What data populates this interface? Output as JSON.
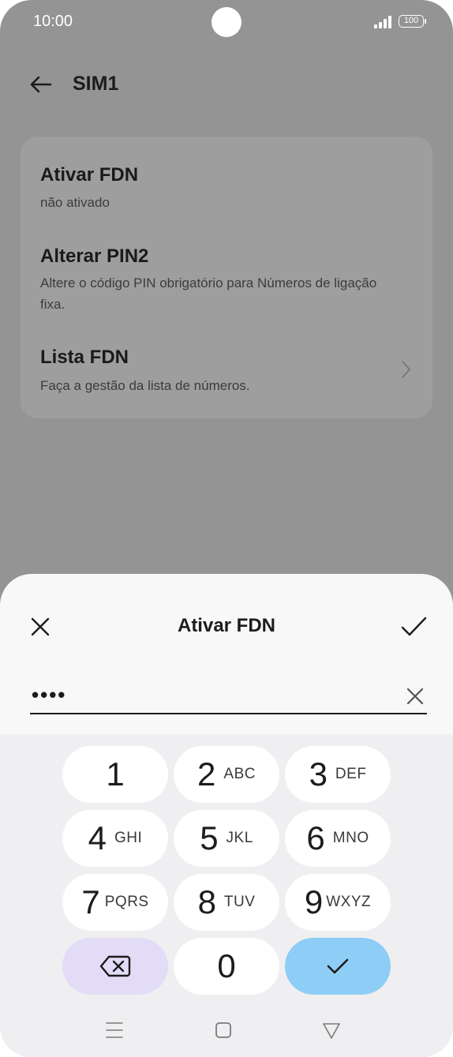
{
  "status_bar": {
    "time": "10:00",
    "battery": "100"
  },
  "header": {
    "title": "SIM1"
  },
  "settings": [
    {
      "title": "Ativar FDN",
      "subtitle": "não ativado"
    },
    {
      "title": "Alterar PIN2",
      "subtitle": "Altere o código PIN obrigatório para Números de ligação fixa."
    },
    {
      "title": "Lista FDN",
      "subtitle": "Faça a gestão da lista de números."
    }
  ],
  "dialog": {
    "title": "Ativar FDN",
    "pin_value": "••••"
  },
  "keypad": {
    "keys": [
      {
        "num": "1",
        "letters": ""
      },
      {
        "num": "2",
        "letters": "ABC"
      },
      {
        "num": "3",
        "letters": "DEF"
      },
      {
        "num": "4",
        "letters": "GHI"
      },
      {
        "num": "5",
        "letters": "JKL"
      },
      {
        "num": "6",
        "letters": "MNO"
      },
      {
        "num": "7",
        "letters": "PQRS"
      },
      {
        "num": "8",
        "letters": "TUV"
      },
      {
        "num": "9",
        "letters": "WXYZ"
      },
      {
        "num": "0",
        "letters": ""
      }
    ]
  },
  "icons": {
    "back": "arrow-left-icon",
    "chevron": "chevron-right-icon",
    "close": "close-icon",
    "confirm": "check-icon",
    "clear": "clear-icon",
    "backspace": "backspace-icon",
    "nav_menu": "menu-icon",
    "nav_home": "home-icon",
    "nav_back": "back-triangle-icon"
  },
  "colors": {
    "scrim": "#949494",
    "sheet": "#f8f8f8",
    "keypad": "#efeff1",
    "delete_key": "#e3dcf6",
    "done_key": "#8ecdf5"
  }
}
